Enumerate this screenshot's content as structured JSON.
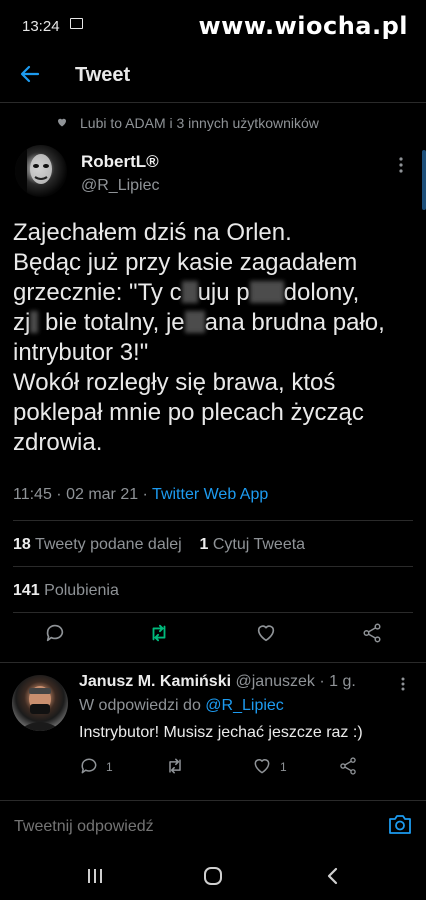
{
  "status": {
    "time": "13:24",
    "watermark": "www.wiocha.pl"
  },
  "topbar": {
    "title": "Tweet"
  },
  "social_context": "Lubi to ADAM i 3 innych użytkowników",
  "tweet": {
    "author_name": "RobertL®",
    "author_handle": "@R_Lipiec",
    "lines": [
      "Zajechałem dziś na Orlen.",
      "Będąc już przy kasie zagadałem",
      [
        "grzecznie: \"Ty c",
        "uju p",
        "dolony,"
      ],
      [
        "zj",
        " bie totalny, je",
        "ana brudna pało,"
      ],
      "intrybutor 3!\"",
      "Wokół rozległy się brawa, ktoś",
      "poklepał mnie po plecach życząc",
      "zdrowia."
    ],
    "timestamp": "11:45 · 02 mar 21 · ",
    "source": "Twitter Web App",
    "retweets_count": "18",
    "retweets_label": "Tweety podane dalej",
    "quotes_count": "1",
    "quotes_label": "Cytuj Tweeta",
    "likes_count": "141",
    "likes_label": "Polubienia"
  },
  "reply": {
    "author_name": "Janusz M. Kamiński",
    "author_handle": "@januszek · 1 g.",
    "reply_to_prefix": "W odpowiedzi do ",
    "reply_to_handle": "@R_Lipiec",
    "text": "Instrybutor! Musisz jechać jeszcze raz :)",
    "reply_count": "1",
    "like_count": "1"
  },
  "composer": {
    "placeholder": "Tweetnij odpowiedź"
  },
  "colors": {
    "accent": "#1d9bf0",
    "retweet_active": "#00ba7c",
    "muted": "#8f9397"
  },
  "icons": [
    "back-arrow-icon",
    "heart-icon",
    "more-icon",
    "reply-icon",
    "retweet-icon",
    "like-icon",
    "share-icon",
    "camera-icon",
    "recent-apps-icon",
    "home-icon",
    "back-icon"
  ]
}
